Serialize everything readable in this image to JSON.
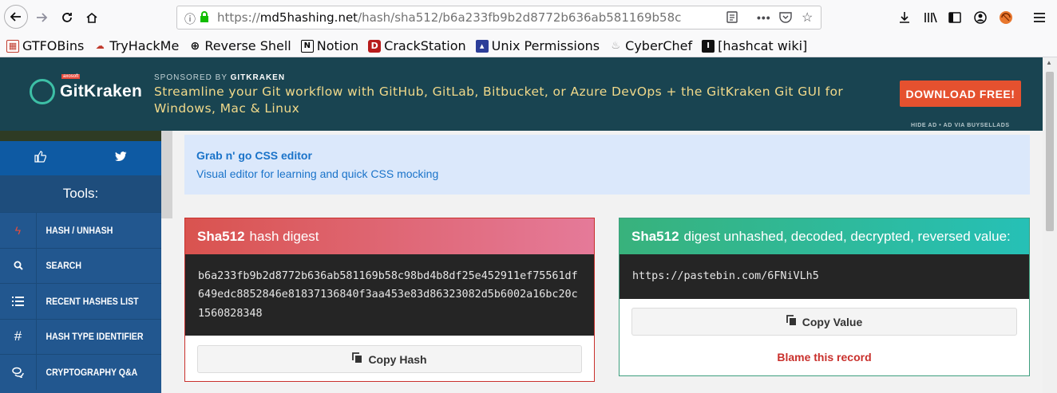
{
  "browser": {
    "url_scheme": "https://",
    "url_host": "md5hashing.net",
    "url_path": "/hash/sha512/b6a233fb9b2d8772b636ab581169b58c",
    "bookmarks": [
      "GTFOBins",
      "TryHackMe",
      "Reverse Shell",
      "Notion",
      "CrackStation",
      "Unix Permissions",
      "CyberChef",
      "[hashcat wiki]"
    ]
  },
  "ad": {
    "logo_name": "GitKraken",
    "logo_badge": "axosoft",
    "sponsored_prefix": "SPONSORED BY",
    "sponsored_by": "GITKRAKEN",
    "text": "Streamline your Git workflow with GitHub, GitLab, Bitbucket, or Azure DevOps + the GitKraken Git GUI for Windows, Mac & Linux",
    "button": "DOWNLOAD FREE!",
    "hide": "HIDE AD • AD VIA BUYSELLADS"
  },
  "sidebar": {
    "tools_label": "Tools:",
    "items": [
      "HASH / UNHASH",
      "SEARCH",
      "RECENT HASHES LIST",
      "HASH TYPE IDENTIFIER",
      "CRYPTOGRAPHY Q&A"
    ]
  },
  "promo": {
    "title": "Grab n' go CSS editor",
    "subtitle": "Visual editor for learning and quick CSS mocking"
  },
  "left_panel": {
    "title_bold": "Sha512",
    "title_rest": "hash digest",
    "hash": "b6a233fb9b2d8772b636ab581169b58c98bd4b8df25e452911ef75561df649edc8852846e81837136840f3aa453e83d86323082d5b6002a16bc20c1560828348",
    "copy_label": "Copy Hash"
  },
  "right_panel": {
    "title_bold": "Sha512",
    "title_rest": "digest unhashed, decoded, decrypted, reversed value:",
    "value": "https://pastebin.com/6FNiVLh5",
    "copy_label": "Copy Value",
    "blame_label": "Blame this record"
  },
  "colors": {
    "ad_bg": "#194451",
    "ad_button": "#e5512f",
    "sidebar_bg": "#22578f",
    "left_head": "#d9534f",
    "right_head": "#26c0b6",
    "blame": "#c9302c"
  }
}
